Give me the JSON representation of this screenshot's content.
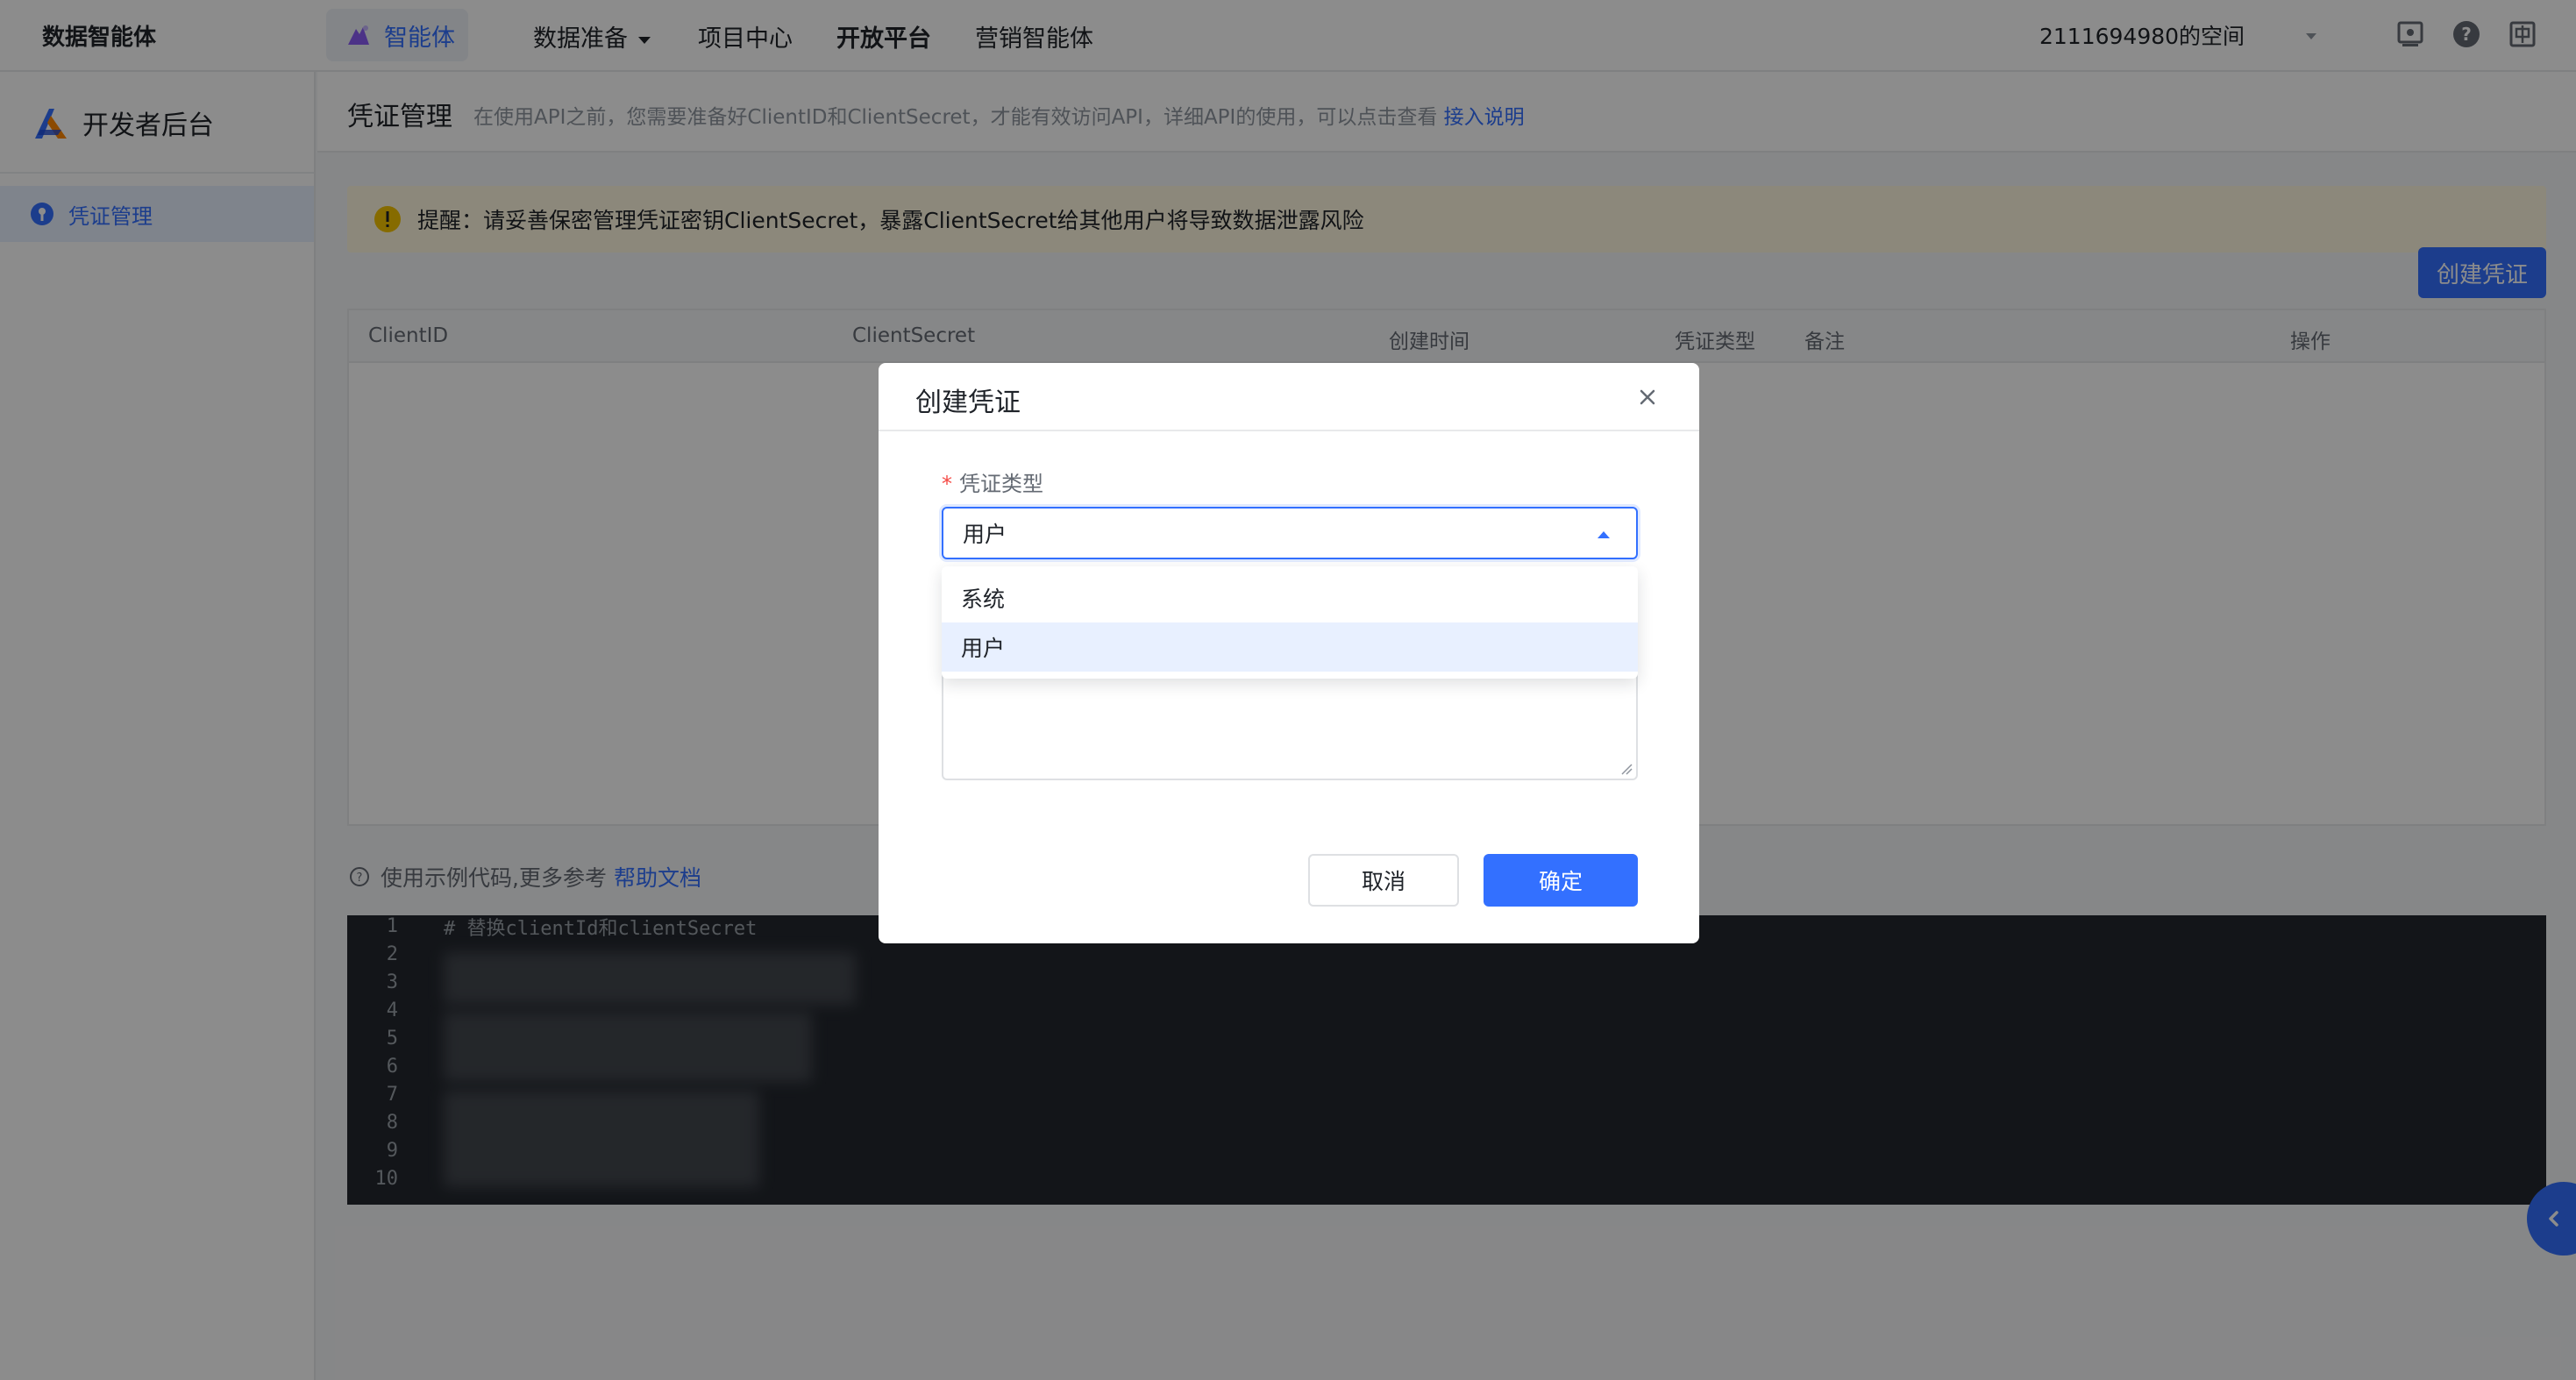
{
  "topbar": {
    "brand": "数据智能体",
    "nav": {
      "agent": "智能体",
      "data_prep": "数据准备",
      "project_center": "项目中心",
      "open_platform": "开放平台",
      "marketing_agent": "营销智能体"
    },
    "space": "2111694980的空间",
    "icons": [
      "screen-icon",
      "help-icon",
      "language-icon"
    ],
    "active_color": "#3370ff"
  },
  "sidebar": {
    "title": "开发者后台",
    "items": [
      {
        "label": "凭证管理",
        "icon": "key-icon",
        "active": true
      }
    ]
  },
  "page": {
    "title": "凭证管理",
    "description": "在使用API之前，您需要准备好ClientID和ClientSecret，才能有效访问API，详细API的使用，可以点击查看",
    "doc_link": "接入说明"
  },
  "warning": {
    "text": "提醒：请妥善保密管理凭证密钥ClientSecret，暴露ClientSecret给其他用户将导致数据泄露风险",
    "color": "#fff7e0"
  },
  "create_button": "创建凭证",
  "table": {
    "columns": [
      "ClientID",
      "ClientSecret",
      "创建时间",
      "凭证类型",
      "备注",
      "操作"
    ]
  },
  "sample": {
    "hint": "使用示例代码,更多参考",
    "link": "帮助文档",
    "line_numbers": [
      "1",
      "2",
      "3",
      "4",
      "5",
      "6",
      "7",
      "8",
      "9",
      "10"
    ],
    "first_line": "# 替换clientId和clientSecret"
  },
  "modal": {
    "title": "创建凭证",
    "field_label": "凭证类型",
    "required_mark": "*",
    "selected_value": "用户",
    "options": [
      "系统",
      "用户"
    ],
    "cancel": "取消",
    "confirm": "确定"
  }
}
